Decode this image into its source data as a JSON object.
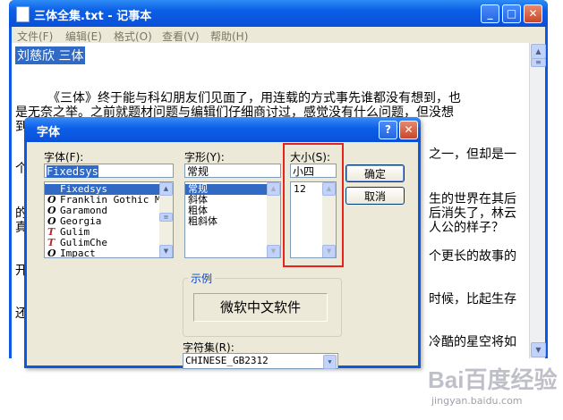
{
  "notepad": {
    "title": "三体全集.txt - 记事本",
    "menu": [
      "文件(F)",
      "编辑(E)",
      "格式(O)",
      "查看(V)",
      "帮助(H)"
    ],
    "selected_line": "刘慈欣  三体",
    "lines": [
      "《三体》终于能与科幻朋友们见面了，用连载的方式事先谁都没有想到，也",
      "是无奈之举。之前就题材问题与编辑们仔细商讨过，感觉没有什么问题，但没想",
      "到",
      "个",
      "的",
      "真",
      "开",
      "还"
    ],
    "right_fragments": [
      "之一，但却是一",
      "生的世界在其后",
      "后消失了，林云",
      "人公的样子？",
      "个更长的故事的",
      "时候，比起生存",
      "冷酷的星空将如"
    ]
  },
  "font_dialog": {
    "title": "字体",
    "help_label": "?",
    "close_label": "✕",
    "font_label": "字体(F):",
    "font_value": "Fixedsys",
    "fonts": [
      {
        "name": "Fixedsys",
        "icon": "",
        "selected": true
      },
      {
        "name": "Franklin Gothic Me",
        "icon": "O"
      },
      {
        "name": "Garamond",
        "icon": "O"
      },
      {
        "name": "Georgia",
        "icon": "O"
      },
      {
        "name": "Gulim",
        "icon": "T"
      },
      {
        "name": "GulimChe",
        "icon": "T"
      },
      {
        "name": "Impact",
        "icon": "O"
      }
    ],
    "style_label": "字形(Y):",
    "style_value": "常规",
    "styles": [
      {
        "name": "常规",
        "selected": true
      },
      {
        "name": "斜体"
      },
      {
        "name": "粗体"
      },
      {
        "name": "粗斜体"
      }
    ],
    "size_label": "大小(S):",
    "size_value": "小四",
    "sizes": [
      "12"
    ],
    "ok_label": "确定",
    "cancel_label": "取消",
    "sample_label": "示例",
    "sample_text": "微软中文软件",
    "charset_label": "字符集(R):",
    "charset_value": "CHINESE_GB2312"
  },
  "watermark": {
    "brand": "Bai百度经验",
    "url": "jingyan.baidu.com"
  },
  "colors": {
    "titlebar": "#0a5ee6",
    "selection": "#316ac5",
    "dialog_bg": "#ece9d8",
    "highlight_box": "#e8221c"
  }
}
